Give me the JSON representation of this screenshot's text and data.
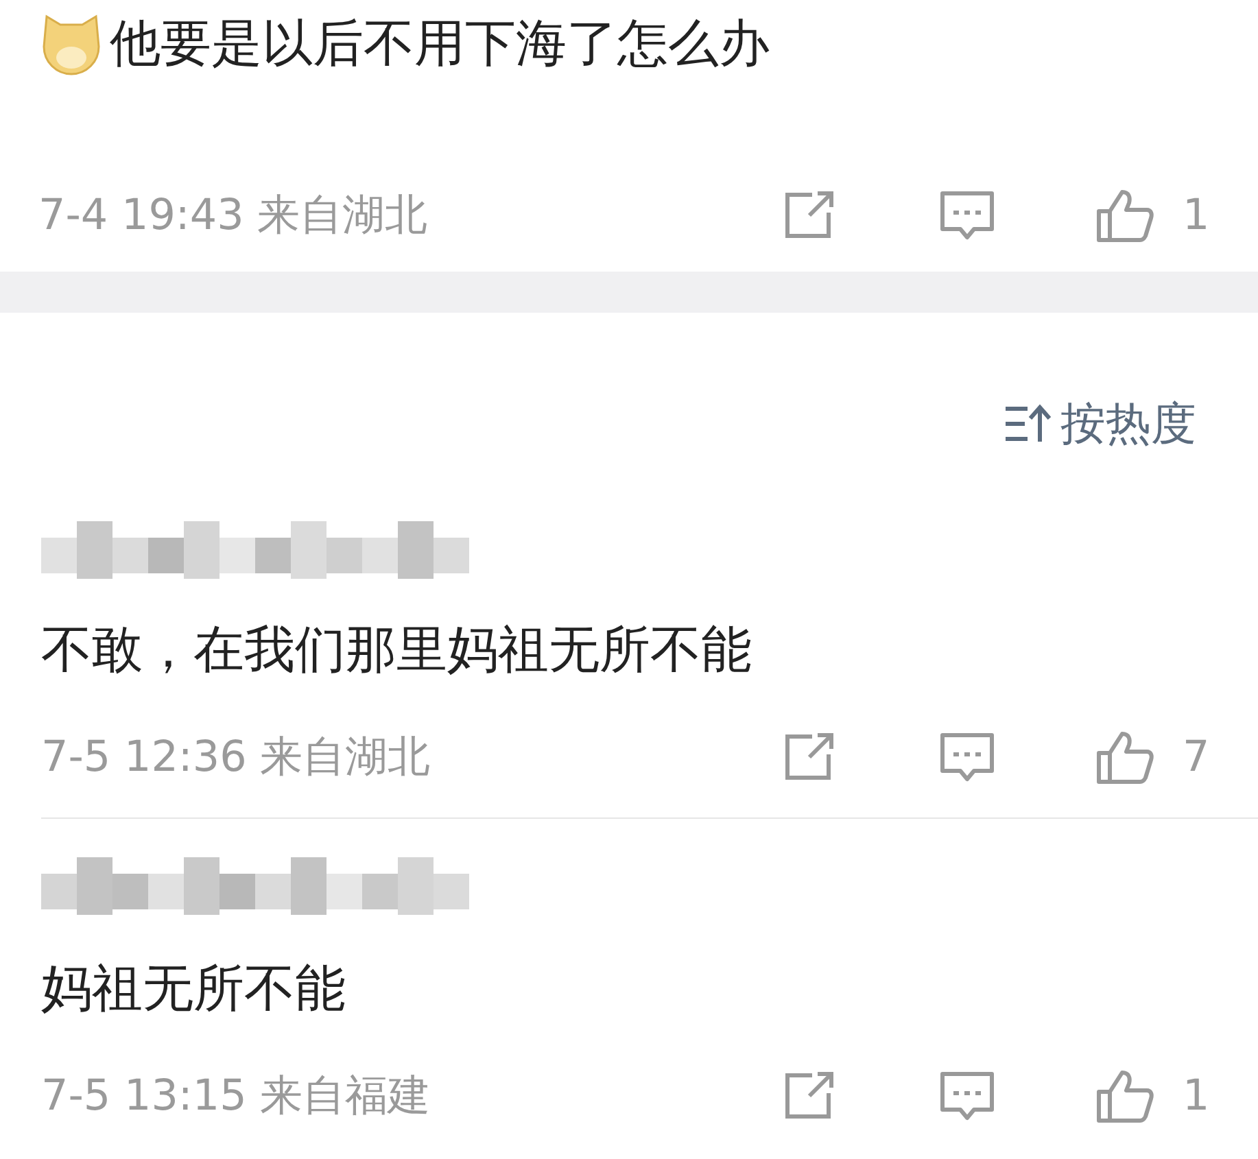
{
  "top_comment": {
    "has_emoji": true,
    "text": "他要是以后不用下海了怎么办",
    "time": "7-4 19:43",
    "location": "来自湖北",
    "likes": "1"
  },
  "sort": {
    "label": "按热度"
  },
  "comments": [
    {
      "username_blurred": true,
      "text": "不敢，在我们那里妈祖无所不能",
      "time": "7-5 12:36",
      "location": "来自湖北",
      "likes": "7"
    },
    {
      "username_blurred": true,
      "text": "妈祖无所不能",
      "time": "7-5 13:15",
      "location": "来自福建",
      "likes": "1"
    }
  ]
}
